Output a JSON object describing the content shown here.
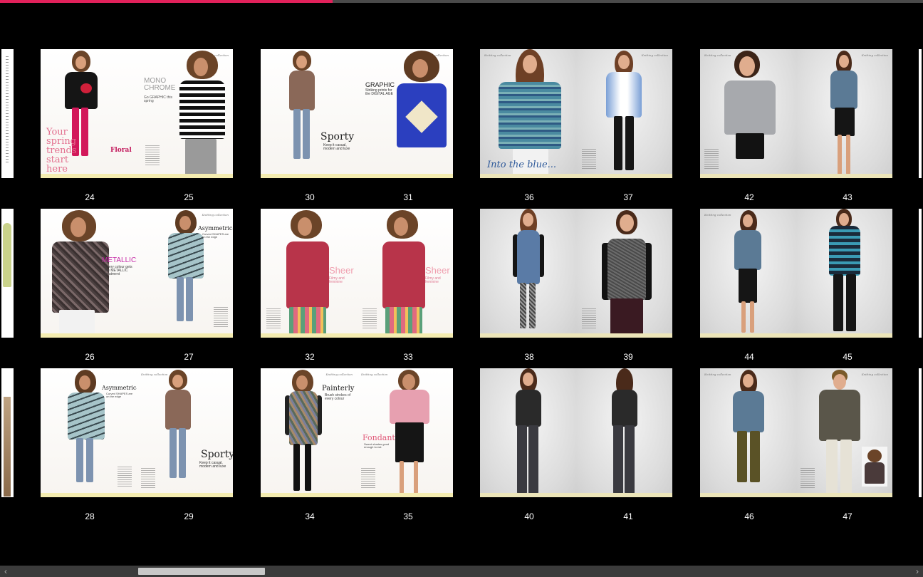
{
  "reading_progress": 0.36,
  "colors": {
    "accent": "#e2215b",
    "footer_band": "#f4ecb0"
  },
  "spreads": [
    {
      "left_number": "24",
      "right_number": "25"
    },
    {
      "left_number": "30",
      "right_number": "31"
    },
    {
      "left_number": "36",
      "right_number": "37"
    },
    {
      "left_number": "42",
      "right_number": "43"
    },
    {
      "left_number": "26",
      "right_number": "27"
    },
    {
      "left_number": "32",
      "right_number": "33"
    },
    {
      "left_number": "38",
      "right_number": "39"
    },
    {
      "left_number": "44",
      "right_number": "45"
    },
    {
      "left_number": "28",
      "right_number": "29"
    },
    {
      "left_number": "34",
      "right_number": "35"
    },
    {
      "left_number": "40",
      "right_number": "41"
    },
    {
      "left_number": "46",
      "right_number": "47"
    }
  ],
  "page_text": {
    "p24_headline": "Your spring trends start here",
    "p24_floral": "Floral",
    "p25_mono": "MONO CHROME",
    "p25_mono_sub": "Go GRAPHIC this spring",
    "p30_sporty": "Sporty",
    "p30_sporty_sub": "Keep it casual, modern and luxe",
    "p31_graphic": "GRAPHIC",
    "p31_graphic_sub": "Striking prints for the DIGITAL AGE",
    "p36_blue": "Into the blue...",
    "p26_metallics": "METALLICS",
    "p26_metallics_sub": "Every colour gets the METALLIC treatment",
    "p27_asym": "Asymmetrical",
    "p27_asym_sub": "Curved SHAPES are on the edge",
    "p32_sheer": "Sheer",
    "p32_sheer_sub": "Filmy and feminine",
    "p33_sheer": "Sheer",
    "p33_sheer_sub": "Filmy and feminine",
    "p28_asym": "Asymmetrical",
    "p28_asym_sub": "Curved SHAPES are on the edge",
    "p29_sporty": "Sporty",
    "p29_sporty_sub": "Keep it casual, modern and luxe",
    "p34_painterly": "Painterly",
    "p34_painterly_sub": "Brush strokes of every colour",
    "p35_fondant": "Fondant",
    "p35_fondant_sub": "Sweet shades good enough to eat"
  }
}
